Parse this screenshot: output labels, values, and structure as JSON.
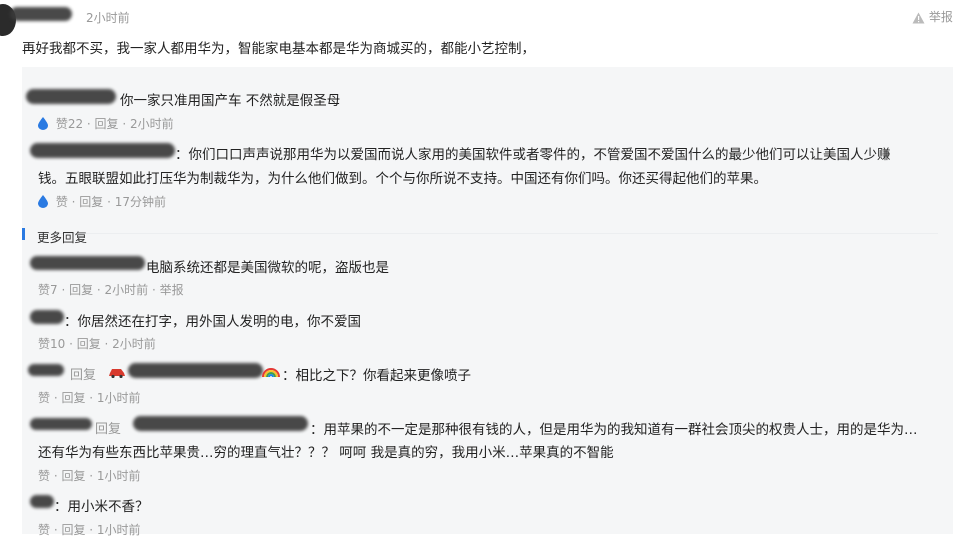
{
  "post": {
    "time": "2小时前",
    "report_label": "举报",
    "content": "再好我都不买，我一家人都用华为，智能家电基本都是华为商城买的，都能小艺控制，"
  },
  "replies": [
    {
      "text": "你一家只准用国产车 不然就是假圣母",
      "meta": "赞22 · 回复 · 2小时前"
    },
    {
      "text_line1": "：你们口口声声说那用华为以爱国而说人家用的美国软件或者零件的，不管爱国不爱国什么的最少他们可以让美国人少赚",
      "text_line2": "钱。五眼联盟如此打压华为制裁华为，为什么他们做到。个个与你所说不支持。中国还有你们吗。你还买得起他们的苹果。",
      "meta": "赞 · 回复 · 17分钟前"
    }
  ],
  "more_replies_label": "更多回复",
  "more": [
    {
      "text": "电脑系统还都是美国微软的呢，盗版也是",
      "meta": "赞7 · 回复 · 2小时前 · 举报"
    },
    {
      "text": "：你居然还在打字，用外国人发明的电，你不爱国",
      "meta": "赞10 · 回复 · 2小时前"
    },
    {
      "reply_word": "回复",
      "text": "：相比之下？你看起来更像喷子",
      "meta": "赞 · 回复 · 1小时前"
    },
    {
      "reply_word": "回复",
      "text_line1": "：用苹果的不一定是那种很有钱的人，但是用华为的我知道有一群社会顶尖的权贵人士，用的是华为…",
      "text_line2": "还有华为有些东西比苹果贵…穷的理直气壮？？？ 呵呵 我是真的穷，我用小米…苹果真的不智能",
      "meta": "赞 · 回复 · 1小时前"
    },
    {
      "text": "：用小米不香？",
      "meta": "赞 · 回复 · 1小时前"
    }
  ],
  "colors": {
    "accent": "#2a7ae2",
    "meta": "#999999",
    "panel": "#f5f6f7"
  },
  "icons": [
    "warning-icon",
    "like-drop-icon",
    "car-emoji-icon",
    "rainbow-emoji-icon"
  ]
}
